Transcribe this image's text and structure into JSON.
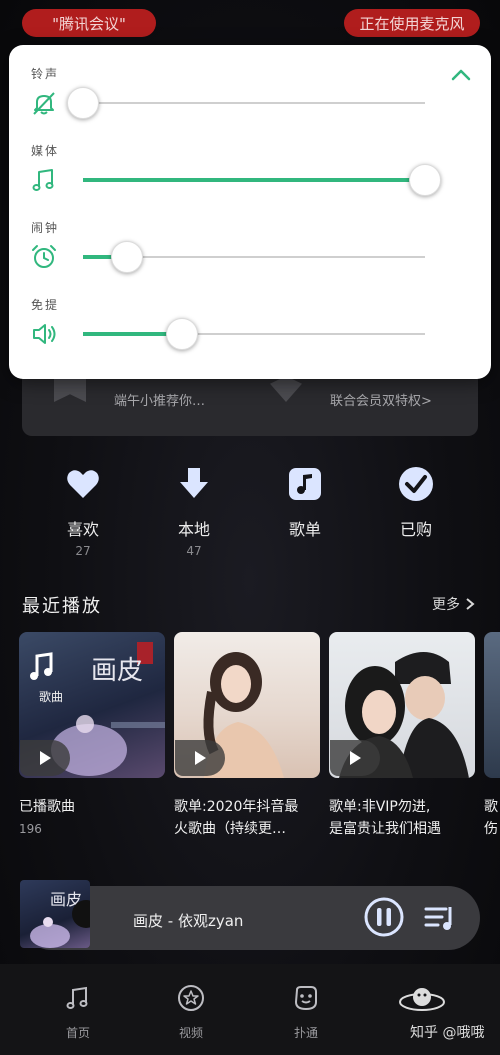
{
  "status_pills": {
    "left": "\"腾讯会议\"",
    "right": "正在使用麦克风"
  },
  "volume_panel": {
    "ringtone_label": "铃声",
    "media_label": "媒体",
    "alarm_label": "闹钟",
    "prompt_label": "免提",
    "ringtone_level": 0.0,
    "media_level": 1.0,
    "alarm_level": 0.13,
    "prompt_level": 0.29,
    "accent": "#31b77e"
  },
  "vip_card": {
    "left_text": "端午小推荐你…",
    "right_text": "联合会员双特权>"
  },
  "quick_actions": [
    {
      "label": "喜欢",
      "count": "27",
      "icon": "heart-icon"
    },
    {
      "label": "本地",
      "count": "47",
      "icon": "download-icon"
    },
    {
      "label": "歌单",
      "count": "",
      "icon": "music-note-icon"
    },
    {
      "label": "已购",
      "count": "",
      "icon": "check-icon"
    }
  ],
  "recent": {
    "title": "最近播放",
    "more": "更多",
    "cards": [
      {
        "title": "已播歌曲",
        "sub": "196",
        "cover_title": "画皮",
        "cover_tag": "歌曲"
      },
      {
        "title": "歌单:2020年抖音最\n火歌曲（持续更…",
        "sub": ""
      },
      {
        "title": "歌单:非VIP勿进,\n是富贵让我们相遇",
        "sub": ""
      },
      {
        "title": "歌\n伤",
        "sub": ""
      }
    ]
  },
  "player": {
    "title": "画皮 - 依观zyan",
    "cover_title": "画皮"
  },
  "nav": [
    {
      "label": "首页",
      "icon": "music-note-icon"
    },
    {
      "label": "视频",
      "icon": "star-circle-icon"
    },
    {
      "label": "扑通",
      "icon": "face-icon"
    }
  ],
  "watermark": "知乎 @哦哦"
}
